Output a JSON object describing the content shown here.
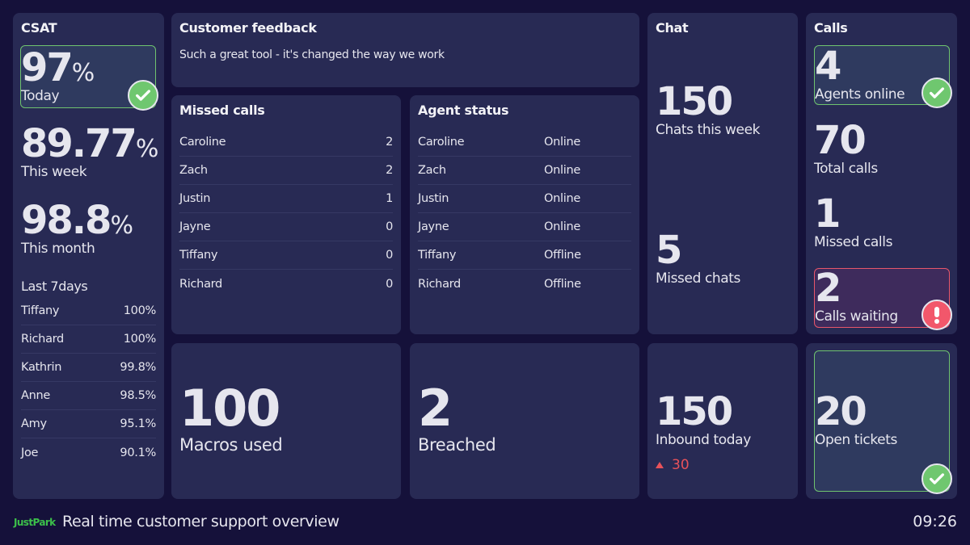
{
  "csat": {
    "title": "CSAT",
    "today": {
      "value": "97",
      "unit": "%",
      "label": "Today",
      "status": "good"
    },
    "week": {
      "value": "89.77",
      "unit": "%",
      "label": "This week"
    },
    "month": {
      "value": "98.8",
      "unit": "%",
      "label": "This month"
    },
    "last7_title": "Last 7days",
    "last7": [
      {
        "name": "Tiffany",
        "value": "100%"
      },
      {
        "name": "Richard",
        "value": "100%"
      },
      {
        "name": "Kathrin",
        "value": "99.8%"
      },
      {
        "name": "Anne",
        "value": "98.5%"
      },
      {
        "name": "Amy",
        "value": "95.1%"
      },
      {
        "name": "Joe",
        "value": "90.1%"
      }
    ]
  },
  "feedback": {
    "title": "Customer feedback",
    "text": "Such a great tool - it's changed the way we work"
  },
  "missed_calls": {
    "title": "Missed calls",
    "rows": [
      {
        "name": "Caroline",
        "value": "2"
      },
      {
        "name": "Zach",
        "value": "2"
      },
      {
        "name": "Justin",
        "value": "1"
      },
      {
        "name": "Jayne",
        "value": "0"
      },
      {
        "name": "Tiffany",
        "value": "0"
      },
      {
        "name": "Richard",
        "value": "0"
      }
    ]
  },
  "agent_status": {
    "title": "Agent status",
    "rows": [
      {
        "name": "Caroline",
        "status": "Online"
      },
      {
        "name": "Zach",
        "status": "Online"
      },
      {
        "name": "Justin",
        "status": "Online"
      },
      {
        "name": "Jayne",
        "status": "Online"
      },
      {
        "name": "Tiffany",
        "status": "Offline"
      },
      {
        "name": "Richard",
        "status": "Offline"
      }
    ]
  },
  "chat": {
    "title": "Chat",
    "week": {
      "value": "150",
      "label": "Chats this week"
    },
    "missed": {
      "value": "5",
      "label": "Missed chats"
    }
  },
  "calls": {
    "title": "Calls",
    "agents_online": {
      "value": "4",
      "label": "Agents online",
      "status": "good"
    },
    "total": {
      "value": "70",
      "label": "Total calls"
    },
    "missed": {
      "value": "1",
      "label": "Missed calls"
    },
    "waiting": {
      "value": "2",
      "label": "Calls waiting",
      "status": "bad"
    }
  },
  "macros": {
    "value": "100",
    "label": "Macros used"
  },
  "breached": {
    "value": "2",
    "label": "Breached"
  },
  "inbound": {
    "value": "150",
    "label": "Inbound today",
    "change": "30",
    "change_direction": "up",
    "change_color": "#e8525a"
  },
  "open_tickets": {
    "value": "20",
    "label": "Open tickets",
    "status": "good"
  },
  "footer": {
    "brand": "JustPark",
    "brand_color": "#3cc04a",
    "title": "Real time customer support overview",
    "time": "09:26"
  },
  "colors": {
    "background": "#15113a",
    "panel": "#282a54",
    "good": "#6fc76f",
    "bad": "#f2576b"
  }
}
